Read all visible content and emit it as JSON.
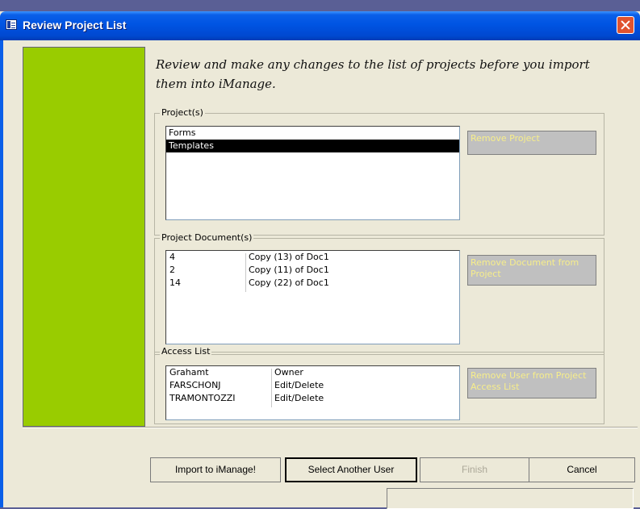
{
  "window": {
    "title": "Review Project List"
  },
  "instructions": "Review and make any changes to the list of projects before you import them into iManage.",
  "projects_group": {
    "label": "Project(s)",
    "items": [
      {
        "name": "Forms",
        "selected": false
      },
      {
        "name": "Templates",
        "selected": true
      }
    ],
    "remove_button": "Remove Project"
  },
  "documents_group": {
    "label": "Project Document(s)",
    "rows": [
      {
        "number": "4",
        "name": "Copy (13) of Doc1"
      },
      {
        "number": "2",
        "name": "Copy (11) of Doc1"
      },
      {
        "number": "14",
        "name": "Copy (22) of Doc1"
      }
    ],
    "remove_button": "Remove Document from Project"
  },
  "access_group": {
    "label": "Access List",
    "rows": [
      {
        "user": "Grahamt",
        "rights": "Owner"
      },
      {
        "user": "FARSCHONJ",
        "rights": "Edit/Delete"
      },
      {
        "user": "TRAMONTOZZI",
        "rights": "Edit/Delete"
      }
    ],
    "remove_button": "Remove User from Project Access List"
  },
  "buttons": {
    "import": "Import to iManage!",
    "select_user": "Select Another User",
    "finish": "Finish",
    "cancel": "Cancel"
  },
  "colors": {
    "accent_panel": "#99cc00",
    "selection": "#000000",
    "disabled_text": "#f7ee8a",
    "titlebar": "#0054e3"
  },
  "icons": {
    "title": "form-icon",
    "close": "close-icon"
  }
}
